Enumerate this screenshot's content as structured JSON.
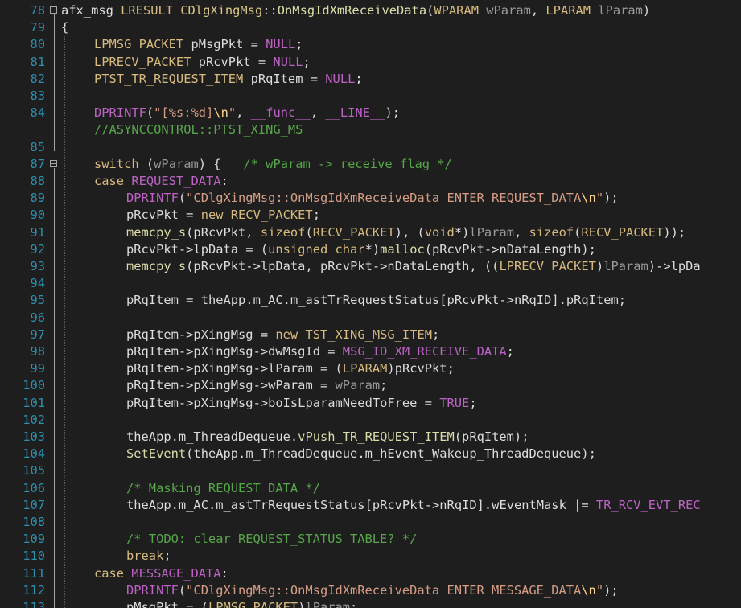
{
  "editor": {
    "lines": [
      {
        "n": "78",
        "fold": true,
        "indent": 0,
        "tokens": [
          [
            "pl",
            "afx_msg "
          ],
          [
            "kw",
            "LRESULT "
          ],
          [
            "ty",
            "CDlgXingMsg"
          ],
          [
            "pl",
            "::"
          ],
          [
            "fn",
            "OnMsgIdXmReceiveData"
          ],
          [
            "pl",
            "("
          ],
          [
            "kw",
            "WPARAM "
          ],
          [
            "pm",
            "wParam"
          ],
          [
            "pl",
            ", "
          ],
          [
            "kw",
            "LPARAM "
          ],
          [
            "pm",
            "lParam"
          ],
          [
            "pl",
            ")"
          ]
        ]
      },
      {
        "n": "79",
        "fold": false,
        "indent": 0,
        "tokens": [
          [
            "pl",
            "{"
          ]
        ]
      },
      {
        "n": "80",
        "fold": false,
        "indent": 1,
        "tokens": [
          [
            "kw",
            "LPMSG_PACKET "
          ],
          [
            "vr",
            "pMsgPkt"
          ],
          [
            "pl",
            " = "
          ],
          [
            "mc",
            "NULL"
          ],
          [
            "pl",
            ";"
          ]
        ]
      },
      {
        "n": "81",
        "fold": false,
        "indent": 1,
        "tokens": [
          [
            "kw",
            "LPRECV_PACKET "
          ],
          [
            "vr",
            "pRcvPkt"
          ],
          [
            "pl",
            " = "
          ],
          [
            "mc",
            "NULL"
          ],
          [
            "pl",
            ";"
          ]
        ]
      },
      {
        "n": "82",
        "fold": false,
        "indent": 1,
        "tokens": [
          [
            "kw",
            "PTST_TR_REQUEST_ITEM "
          ],
          [
            "vr",
            "pRqItem"
          ],
          [
            "pl",
            " = "
          ],
          [
            "mc",
            "NULL"
          ],
          [
            "pl",
            ";"
          ]
        ]
      },
      {
        "n": "83",
        "fold": false,
        "indent": 1,
        "tokens": []
      },
      {
        "n": "84",
        "fold": false,
        "indent": 1,
        "tokens": [
          [
            "mc",
            "DPRINTF"
          ],
          [
            "pl",
            "("
          ],
          [
            "st",
            "\"[%s:%d]"
          ],
          [
            "es",
            "\\n"
          ],
          [
            "st",
            "\""
          ],
          [
            "pl",
            ", "
          ],
          [
            "mc",
            "__func__"
          ],
          [
            "pl",
            ", "
          ],
          [
            "mc",
            "__LINE__"
          ],
          [
            "pl",
            ");"
          ]
        ]
      },
      {
        "n": "84b",
        "label": "",
        "fold": false,
        "indent": 1,
        "tokens": [
          [
            "cm",
            "//ASYNCCONTROL::PTST_XING_MS"
          ]
        ]
      },
      {
        "n": "85",
        "fold": false,
        "indent": 1,
        "tokens": []
      },
      {
        "n": "87",
        "fold": true,
        "indent": 1,
        "tokens": [
          [
            "kw",
            "switch "
          ],
          [
            "pl",
            "("
          ],
          [
            "pm",
            "wParam"
          ],
          [
            "pl",
            ") {   "
          ],
          [
            "cm",
            "/* wParam -> receive flag */"
          ]
        ]
      },
      {
        "n": "88",
        "fold": false,
        "indent": 1,
        "tokens": [
          [
            "kw",
            "case "
          ],
          [
            "mc",
            "REQUEST_DATA"
          ],
          [
            "pl",
            ":"
          ]
        ]
      },
      {
        "n": "89",
        "fold": false,
        "indent": 2,
        "tokens": [
          [
            "mc",
            "DPRINTF"
          ],
          [
            "pl",
            "("
          ],
          [
            "st",
            "\"CDlgXingMsg::OnMsgIdXmReceiveData ENTER REQUEST_DATA"
          ],
          [
            "es",
            "\\n"
          ],
          [
            "st",
            "\""
          ],
          [
            "pl",
            ");"
          ]
        ]
      },
      {
        "n": "90",
        "fold": false,
        "indent": 2,
        "tokens": [
          [
            "vr",
            "pRcvPkt"
          ],
          [
            "pl",
            " = "
          ],
          [
            "kw",
            "new "
          ],
          [
            "kw",
            "RECV_PACKET"
          ],
          [
            "pl",
            ";"
          ]
        ]
      },
      {
        "n": "91",
        "fold": false,
        "indent": 2,
        "tokens": [
          [
            "fn",
            "memcpy_s"
          ],
          [
            "pl",
            "("
          ],
          [
            "vr",
            "pRcvPkt"
          ],
          [
            "pl",
            ", "
          ],
          [
            "kw",
            "sizeof"
          ],
          [
            "pl",
            "("
          ],
          [
            "kw",
            "RECV_PACKET"
          ],
          [
            "pl",
            "), ("
          ],
          [
            "kw",
            "void"
          ],
          [
            "pl",
            "*)"
          ],
          [
            "pm",
            "lParam"
          ],
          [
            "pl",
            ", "
          ],
          [
            "kw",
            "sizeof"
          ],
          [
            "pl",
            "("
          ],
          [
            "kw",
            "RECV_PACKET"
          ],
          [
            "pl",
            "));"
          ]
        ]
      },
      {
        "n": "92",
        "fold": false,
        "indent": 2,
        "tokens": [
          [
            "vr",
            "pRcvPkt"
          ],
          [
            "pl",
            "->"
          ],
          [
            "vr",
            "lpData"
          ],
          [
            "pl",
            " = ("
          ],
          [
            "kw",
            "unsigned char"
          ],
          [
            "pl",
            "*)"
          ],
          [
            "fn",
            "malloc"
          ],
          [
            "pl",
            "("
          ],
          [
            "vr",
            "pRcvPkt"
          ],
          [
            "pl",
            "->"
          ],
          [
            "vr",
            "nDataLength"
          ],
          [
            "pl",
            ");"
          ]
        ]
      },
      {
        "n": "93",
        "fold": false,
        "indent": 2,
        "tokens": [
          [
            "fn",
            "memcpy_s"
          ],
          [
            "pl",
            "("
          ],
          [
            "vr",
            "pRcvPkt"
          ],
          [
            "pl",
            "->"
          ],
          [
            "vr",
            "lpData"
          ],
          [
            "pl",
            ", "
          ],
          [
            "vr",
            "pRcvPkt"
          ],
          [
            "pl",
            "->"
          ],
          [
            "vr",
            "nDataLength"
          ],
          [
            "pl",
            ", (("
          ],
          [
            "kw",
            "LPRECV_PACKET"
          ],
          [
            "pl",
            ")"
          ],
          [
            "pm",
            "lParam"
          ],
          [
            "pl",
            ")->lpDa"
          ]
        ]
      },
      {
        "n": "94",
        "fold": false,
        "indent": 2,
        "tokens": []
      },
      {
        "n": "95",
        "fold": false,
        "indent": 2,
        "tokens": [
          [
            "vr",
            "pRqItem"
          ],
          [
            "pl",
            " = "
          ],
          [
            "vr",
            "theApp"
          ],
          [
            "pl",
            "."
          ],
          [
            "vr",
            "m_AC"
          ],
          [
            "pl",
            "."
          ],
          [
            "vr",
            "m_astTrRequestStatus"
          ],
          [
            "pl",
            "["
          ],
          [
            "vr",
            "pRcvPkt"
          ],
          [
            "pl",
            "->"
          ],
          [
            "vr",
            "nRqID"
          ],
          [
            "pl",
            "]."
          ],
          [
            "vr",
            "pRqItem"
          ],
          [
            "pl",
            ";"
          ]
        ]
      },
      {
        "n": "96",
        "fold": false,
        "indent": 2,
        "tokens": []
      },
      {
        "n": "97",
        "fold": false,
        "indent": 2,
        "tokens": [
          [
            "vr",
            "pRqItem"
          ],
          [
            "pl",
            "->"
          ],
          [
            "vr",
            "pXingMsg"
          ],
          [
            "pl",
            " = "
          ],
          [
            "kw",
            "new "
          ],
          [
            "kw",
            "TST_XING_MSG_ITEM"
          ],
          [
            "pl",
            ";"
          ]
        ]
      },
      {
        "n": "98",
        "fold": false,
        "indent": 2,
        "tokens": [
          [
            "vr",
            "pRqItem"
          ],
          [
            "pl",
            "->"
          ],
          [
            "vr",
            "pXingMsg"
          ],
          [
            "pl",
            "->"
          ],
          [
            "vr",
            "dwMsgId"
          ],
          [
            "pl",
            " = "
          ],
          [
            "mc",
            "MSG_ID_XM_RECEIVE_DATA"
          ],
          [
            "pl",
            ";"
          ]
        ]
      },
      {
        "n": "99",
        "fold": false,
        "indent": 2,
        "tokens": [
          [
            "vr",
            "pRqItem"
          ],
          [
            "pl",
            "->"
          ],
          [
            "vr",
            "pXingMsg"
          ],
          [
            "pl",
            "->"
          ],
          [
            "vr",
            "lParam"
          ],
          [
            "pl",
            " = ("
          ],
          [
            "kw",
            "LPARAM"
          ],
          [
            "pl",
            ")"
          ],
          [
            "vr",
            "pRcvPkt"
          ],
          [
            "pl",
            ";"
          ]
        ]
      },
      {
        "n": "100",
        "fold": false,
        "indent": 2,
        "tokens": [
          [
            "vr",
            "pRqItem"
          ],
          [
            "pl",
            "->"
          ],
          [
            "vr",
            "pXingMsg"
          ],
          [
            "pl",
            "->"
          ],
          [
            "vr",
            "wParam"
          ],
          [
            "pl",
            " = "
          ],
          [
            "pm",
            "wParam"
          ],
          [
            "pl",
            ";"
          ]
        ]
      },
      {
        "n": "101",
        "fold": false,
        "indent": 2,
        "tokens": [
          [
            "vr",
            "pRqItem"
          ],
          [
            "pl",
            "->"
          ],
          [
            "vr",
            "pXingMsg"
          ],
          [
            "pl",
            "->"
          ],
          [
            "vr",
            "boIsLparamNeedToFree"
          ],
          [
            "pl",
            " = "
          ],
          [
            "mc",
            "TRUE"
          ],
          [
            "pl",
            ";"
          ]
        ]
      },
      {
        "n": "102",
        "fold": false,
        "indent": 2,
        "tokens": []
      },
      {
        "n": "103",
        "fold": false,
        "indent": 2,
        "tokens": [
          [
            "vr",
            "theApp"
          ],
          [
            "pl",
            "."
          ],
          [
            "vr",
            "m_ThreadDequeue"
          ],
          [
            "pl",
            "."
          ],
          [
            "fn",
            "vPush_TR_REQUEST_ITEM"
          ],
          [
            "pl",
            "("
          ],
          [
            "vr",
            "pRqItem"
          ],
          [
            "pl",
            ");"
          ]
        ]
      },
      {
        "n": "104",
        "fold": false,
        "indent": 2,
        "tokens": [
          [
            "fn",
            "SetEvent"
          ],
          [
            "pl",
            "("
          ],
          [
            "vr",
            "theApp"
          ],
          [
            "pl",
            "."
          ],
          [
            "vr",
            "m_ThreadDequeue"
          ],
          [
            "pl",
            "."
          ],
          [
            "vr",
            "m_hEvent_Wakeup_ThreadDequeue"
          ],
          [
            "pl",
            ");"
          ]
        ]
      },
      {
        "n": "105",
        "fold": false,
        "indent": 2,
        "tokens": []
      },
      {
        "n": "106",
        "fold": false,
        "indent": 2,
        "tokens": [
          [
            "cm",
            "/* Masking REQUEST_DATA */"
          ]
        ]
      },
      {
        "n": "107",
        "fold": false,
        "indent": 2,
        "tokens": [
          [
            "vr",
            "theApp"
          ],
          [
            "pl",
            "."
          ],
          [
            "vr",
            "m_AC"
          ],
          [
            "pl",
            "."
          ],
          [
            "vr",
            "m_astTrRequestStatus"
          ],
          [
            "pl",
            "["
          ],
          [
            "vr",
            "pRcvPkt"
          ],
          [
            "pl",
            "->"
          ],
          [
            "vr",
            "nRqID"
          ],
          [
            "pl",
            "]."
          ],
          [
            "vr",
            "wEventMask"
          ],
          [
            "pl",
            " |= "
          ],
          [
            "mc",
            "TR_RCV_EVT_REC"
          ]
        ]
      },
      {
        "n": "108",
        "fold": false,
        "indent": 2,
        "tokens": []
      },
      {
        "n": "109",
        "fold": false,
        "indent": 2,
        "tokens": [
          [
            "cm",
            "/* TODO: clear REQUEST_STATUS TABLE? */"
          ]
        ]
      },
      {
        "n": "110",
        "fold": false,
        "indent": 2,
        "tokens": [
          [
            "kw",
            "break"
          ],
          [
            "pl",
            ";"
          ]
        ]
      },
      {
        "n": "111",
        "fold": false,
        "indent": 1,
        "tokens": [
          [
            "kw",
            "case "
          ],
          [
            "mc",
            "MESSAGE_DATA"
          ],
          [
            "pl",
            ":"
          ]
        ]
      },
      {
        "n": "112",
        "fold": false,
        "indent": 2,
        "tokens": [
          [
            "mc",
            "DPRINTF"
          ],
          [
            "pl",
            "("
          ],
          [
            "st",
            "\"CDlgXingMsg::OnMsgIdXmReceiveData ENTER MESSAGE_DATA"
          ],
          [
            "es",
            "\\n"
          ],
          [
            "st",
            "\""
          ],
          [
            "pl",
            ");"
          ]
        ]
      },
      {
        "n": "113",
        "fold": false,
        "indent": 2,
        "tokens": [
          [
            "vr",
            "pMsgPkt"
          ],
          [
            "pl",
            " = ("
          ],
          [
            "kw",
            "LPMSG_PACKET"
          ],
          [
            "pl",
            ")"
          ],
          [
            "pm",
            "lParam"
          ],
          [
            "pl",
            ";"
          ]
        ]
      }
    ]
  }
}
